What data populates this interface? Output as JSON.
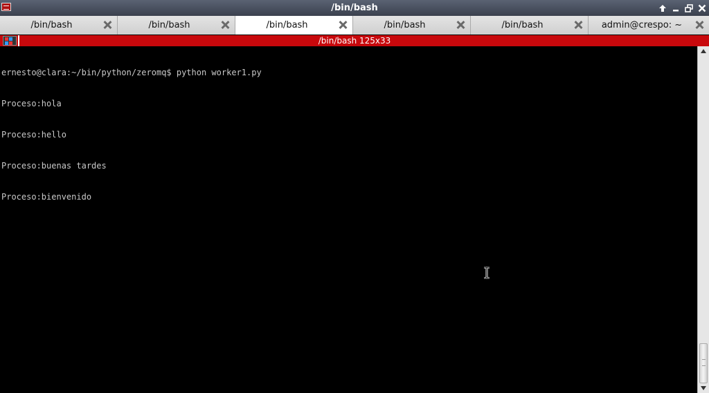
{
  "window": {
    "title": "/bin/bash",
    "controls": [
      "up-arrow-icon",
      "minimize-icon",
      "restore-icon",
      "close-icon"
    ]
  },
  "tabs": [
    {
      "label": "/bin/bash",
      "active": false
    },
    {
      "label": "/bin/bash",
      "active": false
    },
    {
      "label": "/bin/bash",
      "active": true
    },
    {
      "label": "/bin/bash",
      "active": false
    },
    {
      "label": "/bin/bash",
      "active": false
    },
    {
      "label": "admin@crespo: ~",
      "active": false
    }
  ],
  "session": {
    "title": "/bin/bash 125x33",
    "color": "#c8080c"
  },
  "terminal": {
    "lines": [
      "ernesto@clara:~/bin/python/zeromq$ python worker1.py",
      "Proceso:hola",
      "Proceso:hello",
      "Proceso:buenas tardes",
      "Proceso:bienvenido"
    ],
    "background": "#000000",
    "foreground": "#c9c9c9"
  },
  "scrollbar": {
    "position": 1.0
  }
}
